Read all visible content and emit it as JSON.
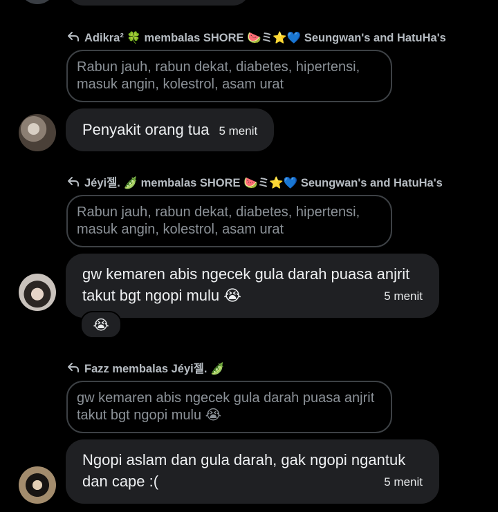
{
  "top_fragments": {},
  "threads": [
    {
      "reply_header": "Adikra² 🍀 membalas SHORE 🍉ミ⭐💙 Seungwan's and HatuHa's",
      "quoted_text": "Rabun jauh, rabun dekat, diabetes, hipertensi, masuk angin, kolestrol, asam urat",
      "message_text": "Penyakit orang tua",
      "timestamp": "5 menit"
    },
    {
      "reply_header": "Jéyi젤. 🫛 membalas SHORE 🍉ミ⭐💙 Seungwan's and HatuHa's",
      "quoted_text": "Rabun jauh, rabun dekat, diabetes, hipertensi, masuk angin, kolestrol, asam urat",
      "message_text": "gw kemaren abis ngecek gula darah puasa anjrit takut bgt ngopi mulu 😭",
      "timestamp": "5 menit",
      "reaction": "😭"
    },
    {
      "reply_header": "Fazz membalas Jéyi젤. 🫛",
      "quoted_text": "gw kemaren abis ngecek gula darah puasa anjrit takut bgt ngopi mulu 😭",
      "message_text": "Ngopi aslam dan gula darah, gak ngopi ngantuk dan cape :(",
      "timestamp": "5 menit"
    }
  ],
  "icons": {
    "reply": "reply-arrow-icon"
  },
  "colors": {
    "background": "#000000",
    "bubble": "#1f2023",
    "quote_border": "#3d4145"
  }
}
